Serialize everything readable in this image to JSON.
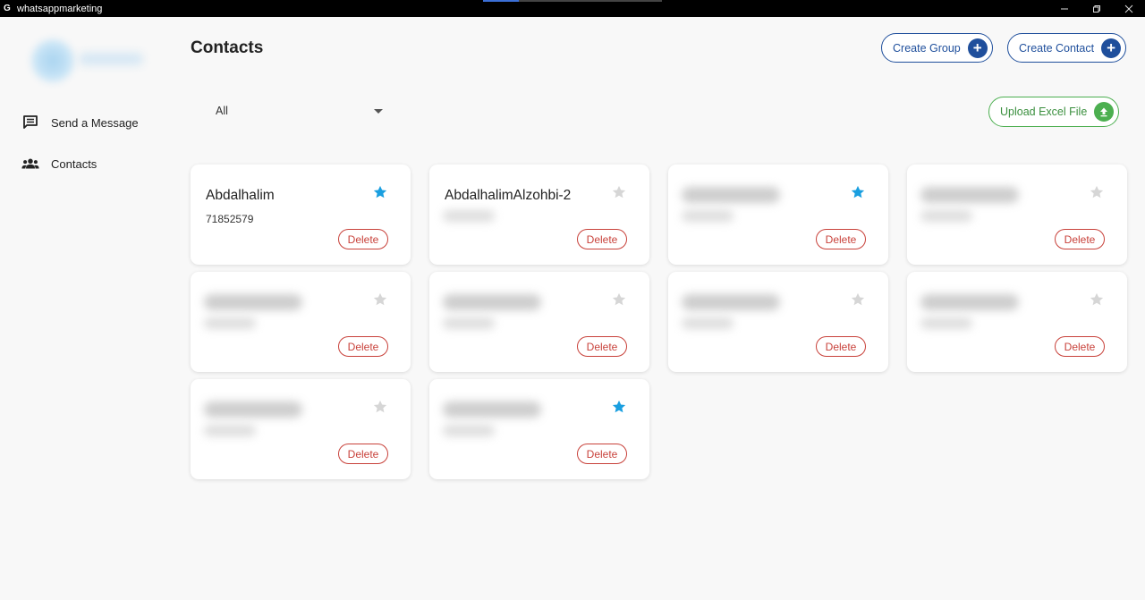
{
  "window": {
    "title": "whatsappmarketing",
    "app_icon_letter": "G",
    "controls": [
      "minimize-icon",
      "restore-icon",
      "close-icon"
    ]
  },
  "sidebar": {
    "items": [
      {
        "label": "Send a Message",
        "icon": "message-icon"
      },
      {
        "label": "Contacts",
        "icon": "people-icon"
      }
    ]
  },
  "main": {
    "title": "Contacts",
    "create_group_label": "Create Group",
    "create_contact_label": "Create Contact",
    "upload_label": "Upload Excel File",
    "filter_value": "All"
  },
  "colors": {
    "primary": "#1f4f9c",
    "upload_green": "#4caf50",
    "delete_red": "#c8413a",
    "star_active": "#1a9fe0",
    "star_inactive": "#d6d6d6"
  },
  "contacts": [
    {
      "name": "Abdalhalim",
      "phone": "71852579",
      "favorite": true,
      "delete_label": "Delete",
      "blurred": false
    },
    {
      "name": "AbdalhalimAlzohbi-2",
      "phone": "",
      "favorite": false,
      "delete_label": "Delete",
      "blurred": false
    },
    {
      "name": "",
      "phone": "",
      "favorite": true,
      "delete_label": "Delete",
      "blurred": true
    },
    {
      "name": "",
      "phone": "",
      "favorite": false,
      "delete_label": "Delete",
      "blurred": true
    },
    {
      "name": "",
      "phone": "",
      "favorite": false,
      "delete_label": "Delete",
      "blurred": true
    },
    {
      "name": "",
      "phone": "",
      "favorite": false,
      "delete_label": "Delete",
      "blurred": true
    },
    {
      "name": "",
      "phone": "",
      "favorite": false,
      "delete_label": "Delete",
      "blurred": true
    },
    {
      "name": "",
      "phone": "",
      "favorite": false,
      "delete_label": "Delete",
      "blurred": true
    },
    {
      "name": "",
      "phone": "",
      "favorite": false,
      "delete_label": "Delete",
      "blurred": true
    },
    {
      "name": "",
      "phone": "",
      "favorite": true,
      "delete_label": "Delete",
      "blurred": true
    }
  ]
}
